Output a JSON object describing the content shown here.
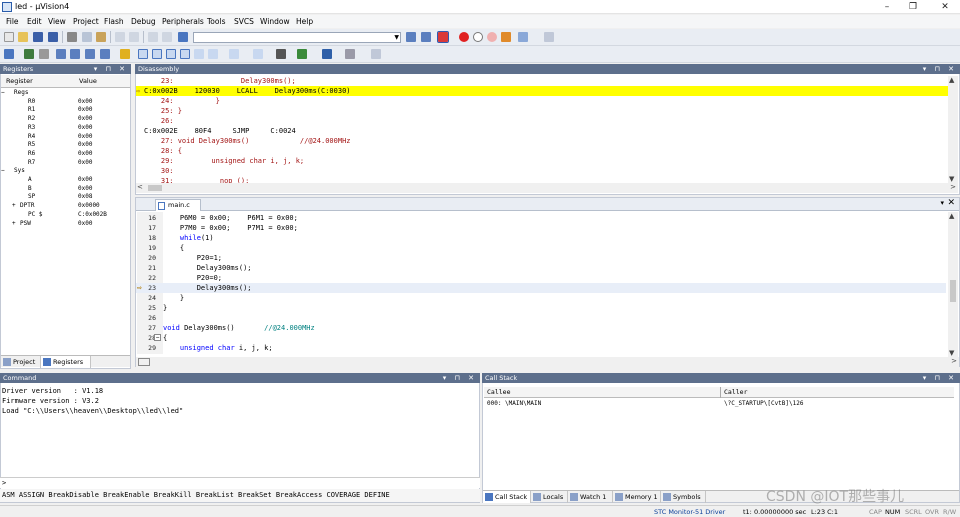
{
  "window": {
    "title": "led - µVision4",
    "controls": [
      "–",
      "❐",
      "✕"
    ]
  },
  "menu": [
    "File",
    "Edit",
    "View",
    "Project",
    "Flash",
    "Debug",
    "Peripherals",
    "Tools",
    "SVCS",
    "Window",
    "Help"
  ],
  "registers": {
    "header": "Registers",
    "columns": [
      "Register",
      "Value"
    ],
    "rows": [
      {
        "name": "Regs",
        "value": "",
        "level": 0,
        "expander": "−"
      },
      {
        "name": "R0",
        "value": "0x00",
        "level": 2,
        "expander": ""
      },
      {
        "name": "R1",
        "value": "0x00",
        "level": 2,
        "expander": ""
      },
      {
        "name": "R2",
        "value": "0x00",
        "level": 2,
        "expander": ""
      },
      {
        "name": "R3",
        "value": "0x00",
        "level": 2,
        "expander": ""
      },
      {
        "name": "R4",
        "value": "0x00",
        "level": 2,
        "expander": ""
      },
      {
        "name": "R5",
        "value": "0x00",
        "level": 2,
        "expander": ""
      },
      {
        "name": "R6",
        "value": "0x00",
        "level": 2,
        "expander": ""
      },
      {
        "name": "R7",
        "value": "0x00",
        "level": 2,
        "expander": ""
      },
      {
        "name": "Sys",
        "value": "",
        "level": 0,
        "expander": "−"
      },
      {
        "name": "A",
        "value": "0x00",
        "level": 2,
        "expander": ""
      },
      {
        "name": "B",
        "value": "0x00",
        "level": 2,
        "expander": ""
      },
      {
        "name": "SP",
        "value": "0x08",
        "level": 2,
        "expander": ""
      },
      {
        "name": "DPTR",
        "value": "0x0000",
        "level": 1,
        "expander": "+"
      },
      {
        "name": "PC $",
        "value": "C:0x002B",
        "level": 2,
        "expander": ""
      },
      {
        "name": "PSW",
        "value": "0x00",
        "level": 1,
        "expander": "+"
      }
    ],
    "tabs": [
      "Project",
      "Registers"
    ]
  },
  "disassembly": {
    "header": "Disassembly",
    "lines": [
      {
        "text": "    23:                Delay300ms();",
        "cls": "src",
        "hl": false,
        "arrow": false
      },
      {
        "text": "C:0x002B    120030    LCALL    Delay300ms(C:0030)",
        "cls": "asm",
        "hl": true,
        "arrow": true
      },
      {
        "text": "    24:          }",
        "cls": "src",
        "hl": false,
        "arrow": false
      },
      {
        "text": "    25: }",
        "cls": "src",
        "hl": false,
        "arrow": false
      },
      {
        "text": "    26:",
        "cls": "src",
        "hl": false,
        "arrow": false
      },
      {
        "text": "C:0x002E    80F4     SJMP     C:0024",
        "cls": "asm",
        "hl": false,
        "arrow": false
      },
      {
        "text": "    27: void Delay300ms()            //@24.000MHz",
        "cls": "src",
        "hl": false,
        "arrow": false
      },
      {
        "text": "    28: {",
        "cls": "src",
        "hl": false,
        "arrow": false
      },
      {
        "text": "    29:         unsigned char i, j, k;",
        "cls": "src",
        "hl": false,
        "arrow": false
      },
      {
        "text": "    30:",
        "cls": "src",
        "hl": false,
        "arrow": false
      },
      {
        "text": "    31:          _nop_();",
        "cls": "src",
        "hl": false,
        "arrow": false
      }
    ]
  },
  "editor": {
    "tab": "main.c",
    "lines": [
      {
        "num": "16",
        "code": "    P6M0 = 0x00;    P6M1 = 0x00;",
        "comment": "",
        "arrow": false,
        "cur": false,
        "fold": ""
      },
      {
        "num": "17",
        "code": "    P7M0 = 0x00;    P7M1 = 0x00;",
        "comment": "",
        "arrow": false,
        "cur": false,
        "fold": ""
      },
      {
        "num": "18",
        "code": "    while(1)",
        "comment": "",
        "arrow": false,
        "cur": false,
        "fold": ""
      },
      {
        "num": "19",
        "code": "    {",
        "comment": "",
        "arrow": false,
        "cur": false,
        "fold": ""
      },
      {
        "num": "20",
        "code": "        P20=1;",
        "comment": "",
        "arrow": false,
        "cur": false,
        "fold": ""
      },
      {
        "num": "21",
        "code": "        Delay300ms();",
        "comment": "",
        "arrow": false,
        "cur": false,
        "fold": ""
      },
      {
        "num": "22",
        "code": "        P20=0;",
        "comment": "",
        "arrow": false,
        "cur": false,
        "fold": ""
      },
      {
        "num": "23",
        "code": "        Delay300ms();",
        "comment": "",
        "arrow": true,
        "cur": true,
        "fold": ""
      },
      {
        "num": "24",
        "code": "    }",
        "comment": "",
        "arrow": false,
        "cur": false,
        "fold": ""
      },
      {
        "num": "25",
        "code": "}",
        "comment": "",
        "arrow": false,
        "cur": false,
        "fold": ""
      },
      {
        "num": "26",
        "code": "",
        "comment": "",
        "arrow": false,
        "cur": false,
        "fold": ""
      },
      {
        "num": "27",
        "code": "void Delay300ms()       ",
        "comment": "//@24.000MHz",
        "arrow": false,
        "cur": false,
        "fold": ""
      },
      {
        "num": "28",
        "code": "{",
        "comment": "",
        "arrow": false,
        "cur": false,
        "fold": "−"
      },
      {
        "num": "29",
        "code": "    unsigned char i, j, k;",
        "comment": "",
        "arrow": false,
        "cur": false,
        "fold": ""
      }
    ]
  },
  "command": {
    "header": "Command",
    "lines": [
      "Driver version   : V1.18",
      "Firmware version : V3.2",
      "Load \"C:\\\\Users\\\\heaven\\\\Desktop\\\\led\\\\led\""
    ],
    "prompt": ">",
    "keywords": "ASM ASSIGN BreakDisable BreakEnable BreakKill BreakList BreakSet BreakAccess COVERAGE DEFINE"
  },
  "callstack": {
    "header": "Call Stack",
    "columns": [
      "Callee",
      "Caller"
    ],
    "rows": [
      {
        "callee": "000: \\MAIN\\MAIN",
        "caller": "\\?C_STARTUP\\[CvtB]\\126"
      }
    ],
    "tabs": [
      "Call Stack",
      "Locals",
      "Watch 1",
      "Memory 1",
      "Symbols"
    ]
  },
  "status": {
    "driver": "STC Monitor-51 Driver",
    "time": "t1: 0.00000000 sec",
    "position": "L:23 C:1",
    "indicators": [
      "CAP",
      "NUM",
      "SCRL",
      "OVR",
      "R/W"
    ],
    "active_indicator": "NUM"
  },
  "watermark": "CSDN @IOT那些事儿",
  "colors": {
    "panel_header": "#5d6f8c",
    "highlight": "#ffff00",
    "keyword": "#0000ff",
    "comment": "#008080",
    "disasm_source": "#a31515",
    "disasm_asm": "#000000",
    "current_line": "#e8eef8"
  }
}
